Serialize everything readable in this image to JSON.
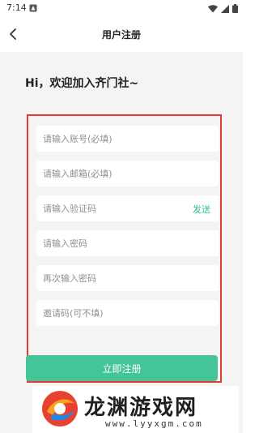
{
  "status_bar": {
    "time": "7:14"
  },
  "header": {
    "back_icon": "chevron-left-icon",
    "title": "用户注册"
  },
  "greeting": "Hi，欢迎加入齐门社~",
  "form": {
    "account_placeholder": "请输入账号(必填)",
    "email_placeholder": "请输入邮箱(必填)",
    "code_placeholder": "请输入验证码",
    "send_label": "发送",
    "password_placeholder": "请输入密码",
    "confirm_placeholder": "再次输入密码",
    "invite_placeholder": "邀请码(可不填)",
    "submit_label": "立即注册"
  },
  "watermark": {
    "title": "龙渊游戏网",
    "url": "www.lyyxgm.com"
  },
  "colors": {
    "accent": "#45c497",
    "highlight_border": "#e53935",
    "background": "#f4f4f4"
  }
}
